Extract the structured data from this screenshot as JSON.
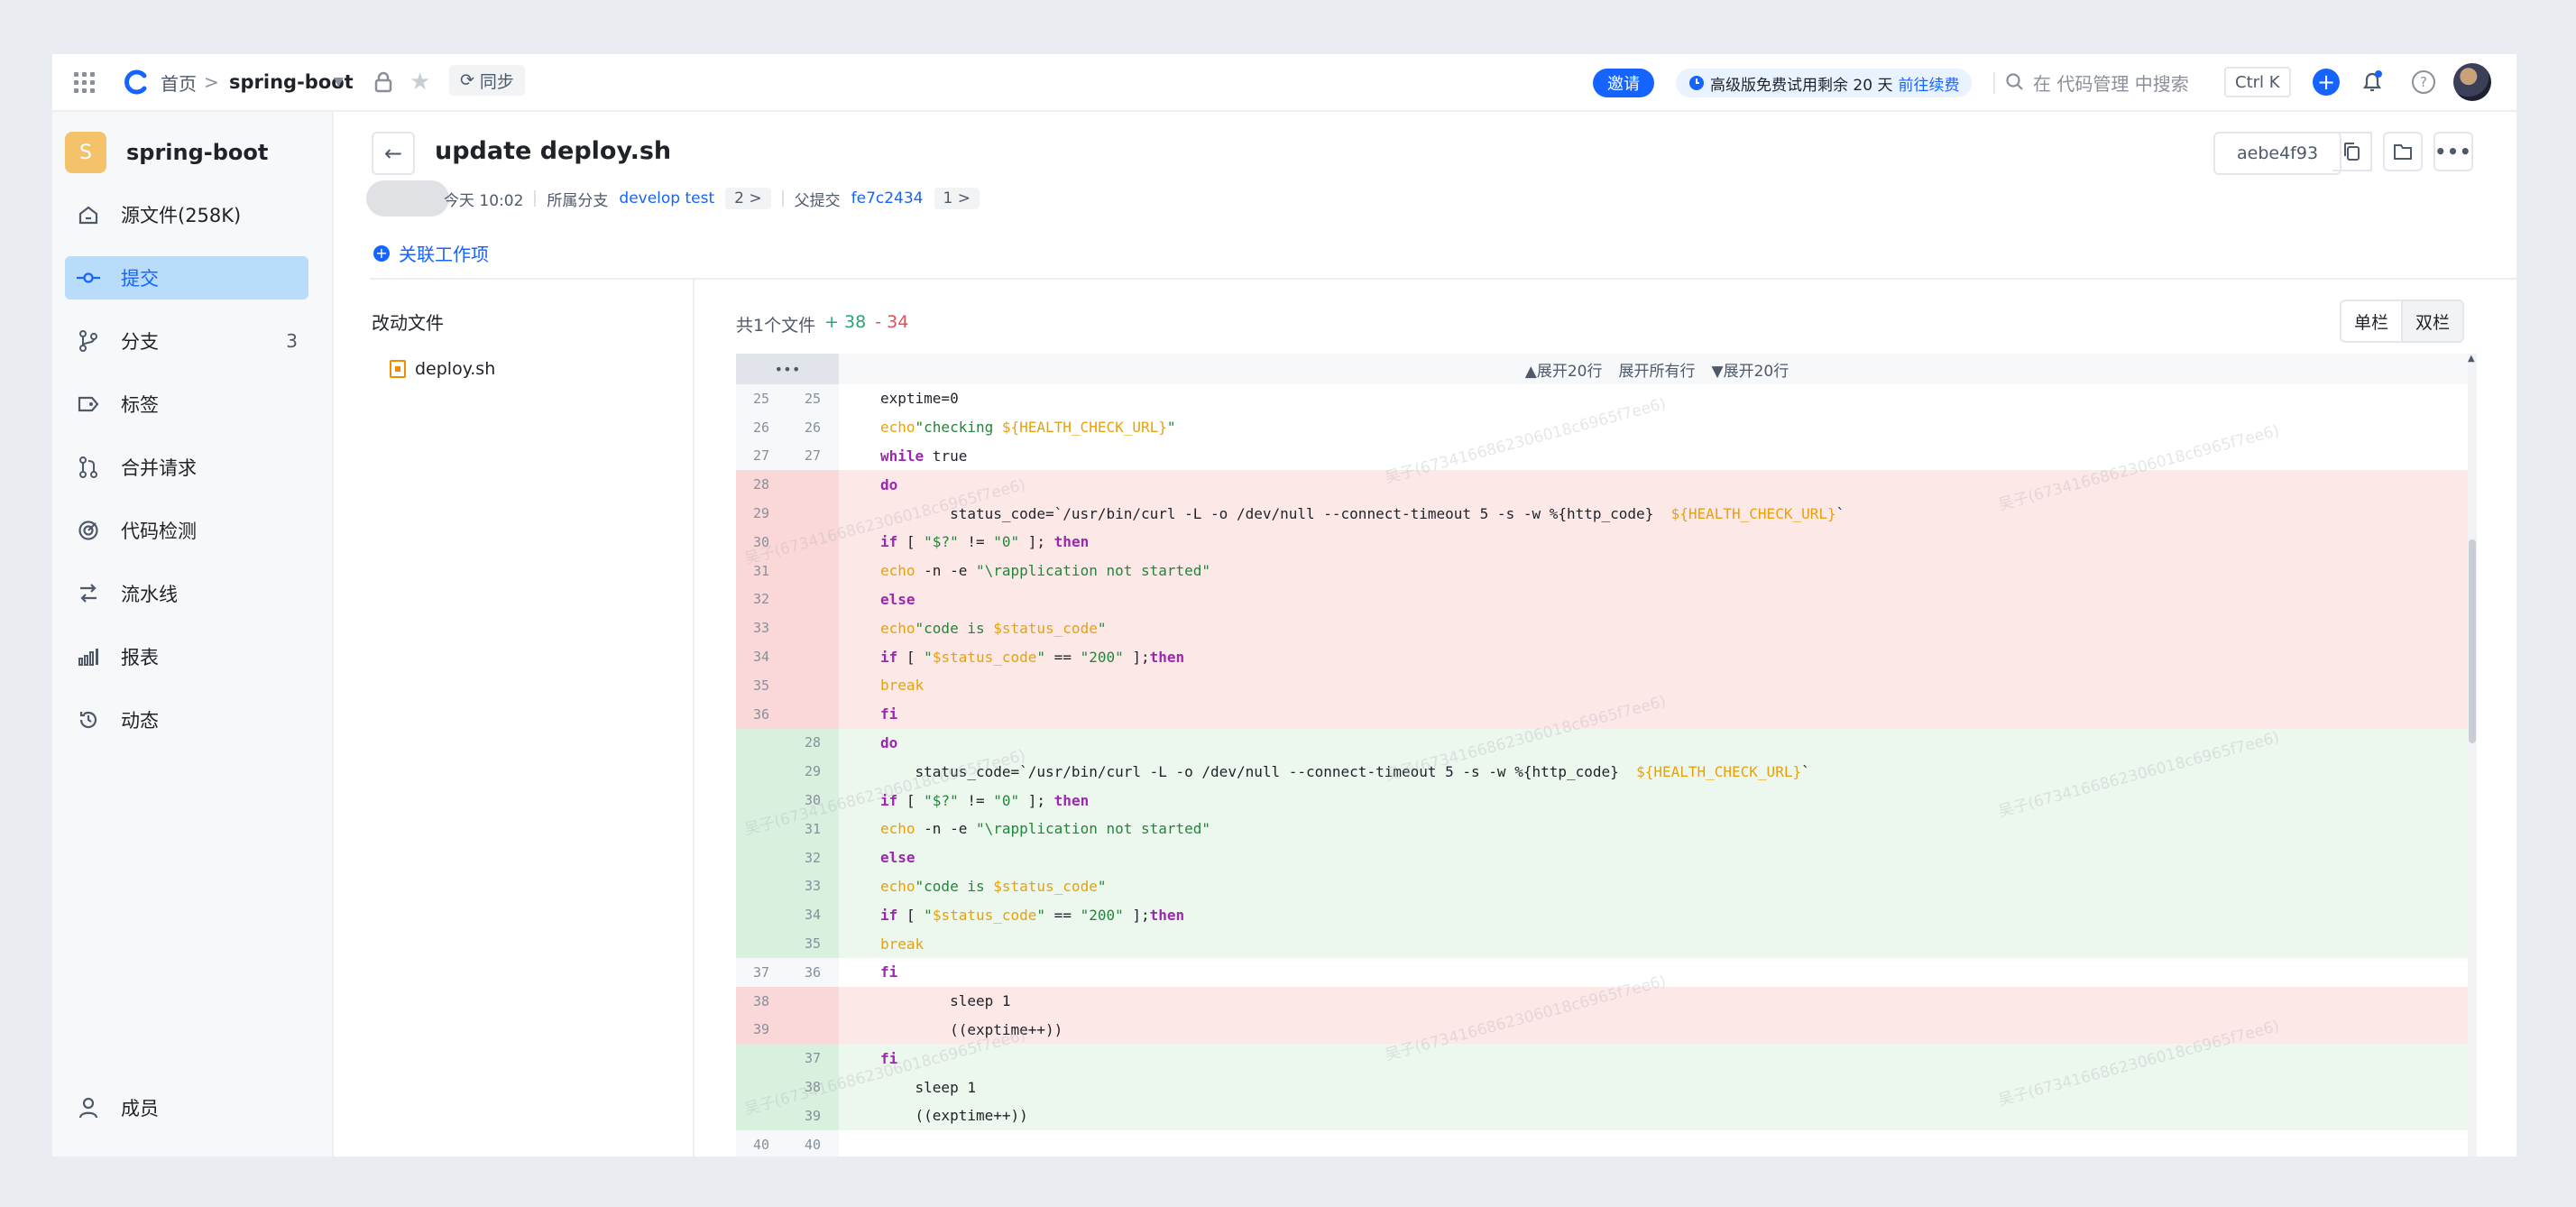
{
  "topbar": {
    "home": "首页",
    "sep": ">",
    "project": "spring-boot",
    "sync": "同步",
    "invite": "邀请",
    "trial_text": "高级版免费试用剩余 20 天",
    "trial_link": "前往续费",
    "search_placeholder": "在 代码管理 中搜索",
    "shortcut": "Ctrl K",
    "help": "?",
    "plus": "+"
  },
  "sidebar": {
    "badge": "S",
    "project": "spring-boot",
    "items": [
      {
        "label": "源文件(258K)",
        "icon": "home-icon"
      },
      {
        "label": "提交",
        "icon": "commit-icon"
      },
      {
        "label": "分支",
        "icon": "branch-icon",
        "count": "3"
      },
      {
        "label": "标签",
        "icon": "tag-icon"
      },
      {
        "label": "合并请求",
        "icon": "merge-request-icon"
      },
      {
        "label": "代码检测",
        "icon": "code-scan-icon"
      },
      {
        "label": "流水线",
        "icon": "pipeline-icon"
      },
      {
        "label": "报表",
        "icon": "report-icon"
      },
      {
        "label": "动态",
        "icon": "history-icon"
      }
    ],
    "members": "成员"
  },
  "commit": {
    "title": "update deploy.sh",
    "time": "今天 10:02",
    "branch_label": "所属分支",
    "branches": "develop  test",
    "branch_more": "2 >",
    "parent_label": "父提交",
    "parent_hash": "fe7c2434",
    "parent_more": "1 >",
    "hash": "aebe4f93",
    "related": "关联工作项"
  },
  "files": {
    "title": "改动文件",
    "items": [
      "deploy.sh"
    ]
  },
  "diff": {
    "summary_prefix": "共1个文件",
    "additions": "+ 38",
    "deletions": "- 34",
    "view_single": "单栏",
    "view_split": "双栏",
    "expand_up": "▲展开20行",
    "expand_all": "展开所有行",
    "expand_down": "▼展开20行",
    "ellipsis": "•••"
  },
  "watermark": "吴子(6734166862306018c6965f7ee6)"
}
